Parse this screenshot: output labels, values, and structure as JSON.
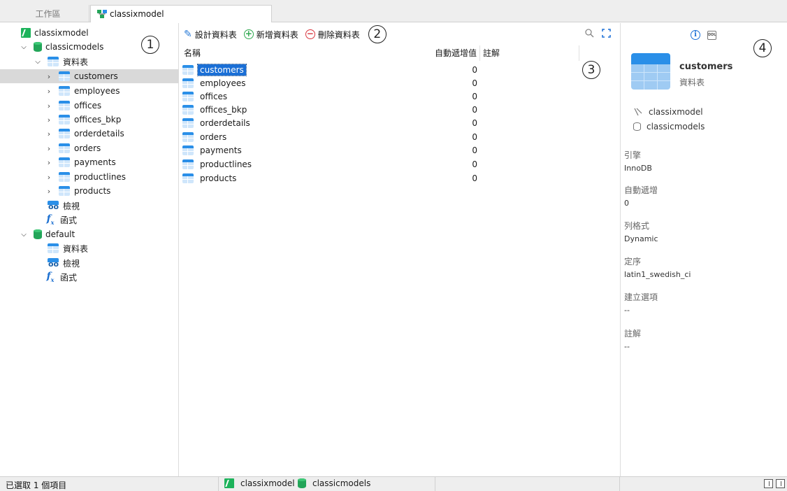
{
  "tabs": {
    "workspace": "工作區",
    "model": "classixmodel"
  },
  "tree": {
    "connection": "classixmodel",
    "db1": {
      "name": "classicmodels",
      "tables_group": "資料表",
      "tables": [
        "customers",
        "employees",
        "offices",
        "offices_bkp",
        "orderdetails",
        "orders",
        "payments",
        "productlines",
        "products"
      ],
      "views": "檢視",
      "functions": "函式"
    },
    "db2": {
      "name": "default",
      "tables_group": "資料表",
      "views": "檢視",
      "functions": "函式"
    }
  },
  "toolbar": {
    "design": "設計資料表",
    "new": "新增資料表",
    "delete": "刪除資料表"
  },
  "grid": {
    "headers": {
      "name": "名稱",
      "auto_increment": "自動遞增值",
      "comment": "註解"
    },
    "rows": [
      {
        "name": "customers",
        "auto": "0"
      },
      {
        "name": "employees",
        "auto": "0"
      },
      {
        "name": "offices",
        "auto": "0"
      },
      {
        "name": "offices_bkp",
        "auto": "0"
      },
      {
        "name": "orderdetails",
        "auto": "0"
      },
      {
        "name": "orders",
        "auto": "0"
      },
      {
        "name": "payments",
        "auto": "0"
      },
      {
        "name": "productlines",
        "auto": "0"
      },
      {
        "name": "products",
        "auto": "0"
      }
    ]
  },
  "info": {
    "title": "customers",
    "subtitle": "資料表",
    "connection": "classixmodel",
    "database": "classicmodels",
    "props": [
      {
        "label": "引擎",
        "value": "InnoDB"
      },
      {
        "label": "自動遞增",
        "value": "0"
      },
      {
        "label": "列格式",
        "value": "Dynamic"
      },
      {
        "label": "定序",
        "value": "latin1_swedish_ci"
      },
      {
        "label": "建立選項",
        "value": "--"
      },
      {
        "label": "註解",
        "value": "--"
      }
    ],
    "ddl_icon_text": "DDL"
  },
  "annotations": [
    "1",
    "2",
    "3",
    "4"
  ],
  "status": {
    "selection": "已選取 1 個項目",
    "connection": "classixmodel",
    "database": "classicmodels"
  },
  "colors": {
    "accent": "#1a6fd6",
    "connection_green": "#1db35b",
    "db_green": "#23a559",
    "delete_red": "#d9363e",
    "add_green": "#2fa84f"
  }
}
